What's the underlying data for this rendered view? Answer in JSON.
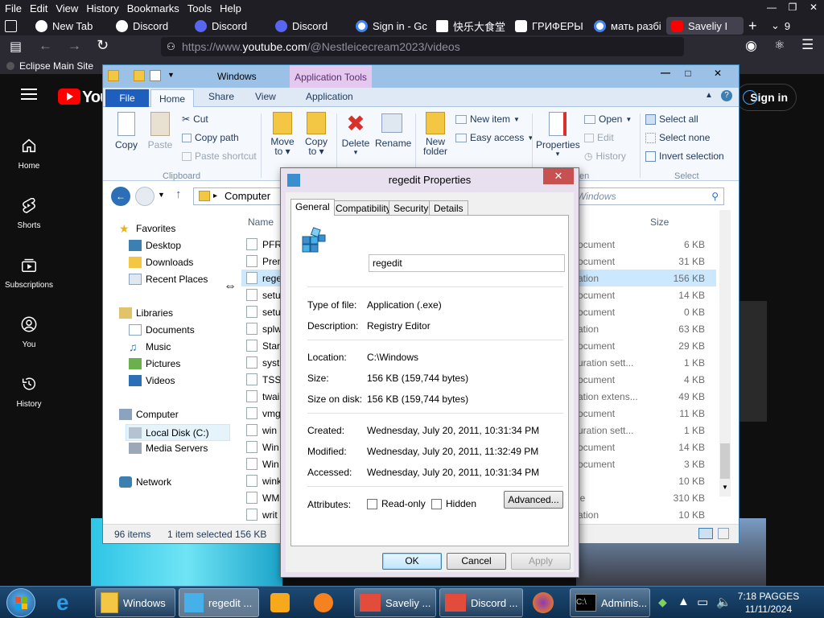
{
  "firefox": {
    "menu": [
      "File",
      "Edit",
      "View",
      "History",
      "Bookmarks",
      "Tools",
      "Help"
    ],
    "tabs": [
      {
        "label": "New Tab",
        "color": "#ffffff"
      },
      {
        "label": "Discord",
        "color": "#5865f2"
      },
      {
        "label": "Discord",
        "color": "#5865f2"
      },
      {
        "label": "Discord",
        "color": "#5865f2"
      },
      {
        "label": "Sign in - Gc",
        "color": "#ffffff"
      },
      {
        "label": "快乐大食堂",
        "color": "#ffffff"
      },
      {
        "label": "ГРИФЕРЫ",
        "color": "#ffffff"
      },
      {
        "label": "мать разбі",
        "color": "#ffffff"
      },
      {
        "label": "Saveliy I",
        "color": "#ff0000"
      }
    ],
    "tab_count": "9",
    "url_prefix": "https://www.",
    "url_host": "youtube.com",
    "url_path": "/@Nestleicecream2023/videos",
    "bookmark": "Eclipse Main Site"
  },
  "youtube": {
    "logo_text": "You",
    "sign_in": "Sign in",
    "nav": [
      {
        "label": "Home",
        "icon": "home-icon"
      },
      {
        "label": "Shorts",
        "icon": "shorts-icon"
      },
      {
        "label": "Subscriptions",
        "icon": "subscriptions-icon"
      },
      {
        "label": "You",
        "icon": "you-icon"
      },
      {
        "label": "History",
        "icon": "history-icon"
      }
    ]
  },
  "explorer": {
    "title": "Windows",
    "context_tab": "Application Tools",
    "ribbon_tabs": {
      "file": "File",
      "home": "Home",
      "share": "Share",
      "view": "View",
      "application": "Application"
    },
    "ribbon": {
      "copy": "Copy",
      "paste": "Paste",
      "cut": "Cut",
      "copy_path": "Copy path",
      "paste_shortcut": "Paste shortcut",
      "group_clipboard": "Clipboard",
      "move_to": "Move",
      "move_to2": "to",
      "copy_to": "Copy",
      "copy_to2": "to",
      "delete": "Delete",
      "rename": "Rename",
      "new_folder": "New",
      "new_folder2": "folder",
      "new_item": "New item",
      "easy_access": "Easy access",
      "properties": "Properties",
      "open": "Open",
      "edit": "Edit",
      "history": "History",
      "group_open": "en",
      "select_all": "Select all",
      "select_none": "Select none",
      "invert_selection": "Invert selection",
      "group_select": "Select"
    },
    "address": "Computer",
    "search_placeholder": "Windows",
    "nav": {
      "favorites": "Favorites",
      "desktop": "Desktop",
      "downloads": "Downloads",
      "recent": "Recent Places",
      "libraries": "Libraries",
      "documents": "Documents",
      "music": "Music",
      "pictures": "Pictures",
      "videos": "Videos",
      "computer": "Computer",
      "local_disk": "Local Disk (C:)",
      "media_servers": "Media Servers",
      "network": "Network"
    },
    "columns": {
      "name": "Name",
      "size": "Size"
    },
    "files": [
      {
        "name": "PFR",
        "type": "ocument",
        "size": "6 KB"
      },
      {
        "name": "Pren",
        "type": "ocument",
        "size": "31 KB"
      },
      {
        "name": "rege",
        "type": "ation",
        "size": "156 KB"
      },
      {
        "name": "setu",
        "type": "ocument",
        "size": "14 KB"
      },
      {
        "name": "setu",
        "type": "ocument",
        "size": "0 KB"
      },
      {
        "name": "splw",
        "type": "ation",
        "size": "63 KB"
      },
      {
        "name": "Star",
        "type": "ocument",
        "size": "29 KB"
      },
      {
        "name": "syst",
        "type": "uration sett...",
        "size": "1 KB"
      },
      {
        "name": "TSS",
        "type": "ocument",
        "size": "4 KB"
      },
      {
        "name": "twai",
        "type": "ation extens...",
        "size": "49 KB"
      },
      {
        "name": "vmg",
        "type": "ocument",
        "size": "11 KB"
      },
      {
        "name": "win",
        "type": "uration sett...",
        "size": "1 KB"
      },
      {
        "name": "Win",
        "type": "ocument",
        "size": "14 KB"
      },
      {
        "name": "Win",
        "type": "ocument",
        "size": "3 KB"
      },
      {
        "name": "wink",
        "type": "",
        "size": "10 KB"
      },
      {
        "name": "WM",
        "type": "le",
        "size": "310 KB"
      },
      {
        "name": "writ",
        "type": "ation",
        "size": "10 KB"
      }
    ],
    "status_count": "96 items",
    "status_selected": "1 item selected  156 KB"
  },
  "dialog": {
    "title": "regedit Properties",
    "close": "✕",
    "tabs": [
      "General",
      "Compatibility",
      "Security",
      "Details"
    ],
    "name": "regedit",
    "labels": {
      "type": "Type of file:",
      "description": "Description:",
      "location": "Location:",
      "size": "Size:",
      "size_on_disk": "Size on disk:",
      "created": "Created:",
      "modified": "Modified:",
      "accessed": "Accessed:",
      "attributes": "Attributes:"
    },
    "values": {
      "type": "Application (.exe)",
      "description": "Registry Editor",
      "location": "C:\\Windows",
      "size": "156 KB (159,744 bytes)",
      "size_on_disk": "156 KB (159,744 bytes)",
      "created": "Wednesday, July 20, 2011, 10:31:34 PM",
      "modified": "Wednesday, July 20, 2011, 11:32:49 PM",
      "accessed": "Wednesday, July 20, 2011, 10:31:34 PM"
    },
    "readonly": "Read-only",
    "hidden": "Hidden",
    "advanced": "Advanced...",
    "ok": "OK",
    "cancel": "Cancel",
    "apply": "Apply"
  },
  "taskbar": {
    "windows_label": "Windows",
    "regedit_label": "regedit ...",
    "saveliy_label": "Saveliy ...",
    "discord_label": "Discord ...",
    "admin_label": "Adminis...",
    "time": "7:18 PAGGES",
    "date": "11/11/2024"
  }
}
